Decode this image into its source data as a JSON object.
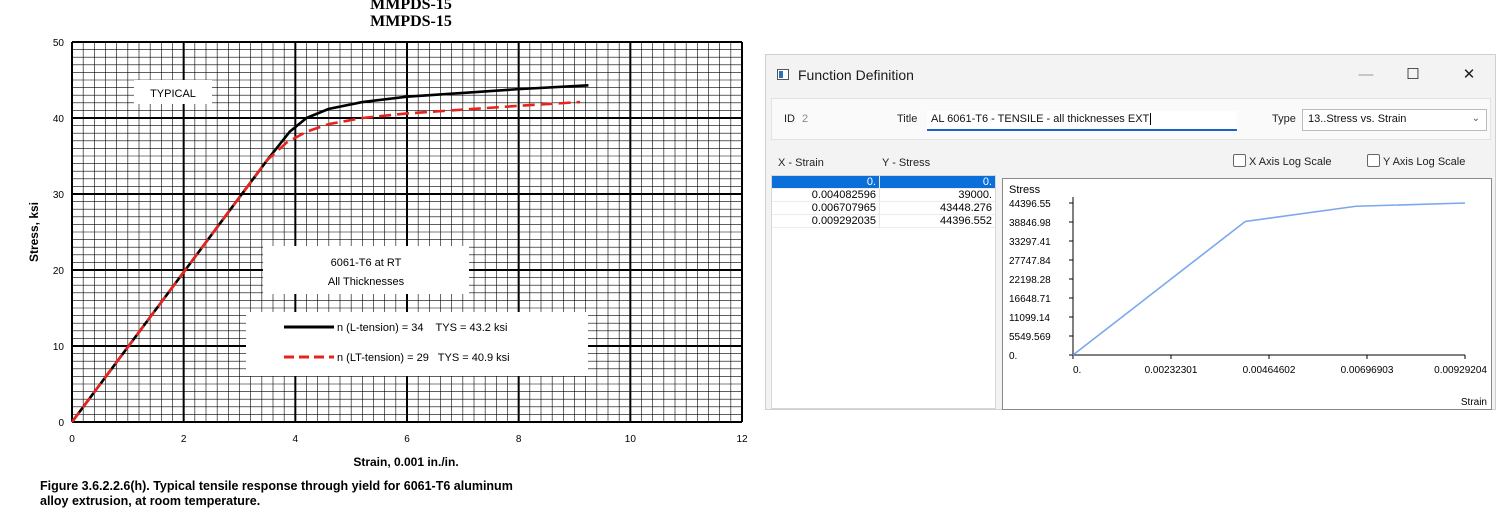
{
  "figure": {
    "header": "MMPDS-15",
    "typical_label": "TYPICAL",
    "legend": {
      "title_line1": "6061-T6 at RT",
      "title_line2": "All Thicknesses",
      "entry1": "n (L-tension) = 34    TYS = 43.2 ksi",
      "entry2": "n (LT-tension) = 29   TYS = 40.9 ksi"
    },
    "caption_line1": "Figure 3.6.2.2.6(h).  Typical tensile response through yield for 6061-T6 aluminum",
    "caption_line2": "alloy extrusion, at room temperature."
  },
  "chart_data": [
    {
      "type": "line",
      "title": "MMPDS-15",
      "xlabel": "Strain, 0.001 in./in.",
      "ylabel": "Stress, ksi",
      "xlim": [
        0,
        12
      ],
      "ylim": [
        0,
        50
      ],
      "x_ticks": [
        "0",
        "2",
        "4",
        "6",
        "8",
        "10",
        "12"
      ],
      "y_ticks": [
        "0",
        "10",
        "20",
        "30",
        "40",
        "50"
      ],
      "grid": true,
      "series": [
        {
          "name": "n (L-tension) = 34    TYS = 43.2 ksi",
          "color": "#000000",
          "style": "solid",
          "x": [
            0,
            3.5,
            3.9,
            4.2,
            4.6,
            5.2,
            6,
            7,
            8,
            9.25
          ],
          "y": [
            0,
            34.5,
            38.2,
            40.0,
            41.2,
            42.1,
            42.8,
            43.3,
            43.8,
            44.3
          ]
        },
        {
          "name": "n (LT-tension) = 29   TYS = 40.9 ksi",
          "color": "#e8231f",
          "style": "dashed",
          "x": [
            0,
            3.5,
            3.85,
            4.2,
            4.6,
            5.2,
            6,
            7,
            8,
            9.1
          ],
          "y": [
            0,
            34.5,
            36.8,
            38.2,
            39.2,
            40.0,
            40.6,
            41.1,
            41.6,
            42.1
          ]
        }
      ]
    },
    {
      "type": "line",
      "title": "",
      "ylabel": "Stress",
      "xlabel": "Strain",
      "x_ticks": [
        "0.",
        "0.00232301",
        "0.00464602",
        "0.00696903",
        "0.00929204"
      ],
      "y_ticks": [
        "0.",
        "5549.569",
        "11099.14",
        "16648.71",
        "22198.28",
        "27747.84",
        "33297.41",
        "38846.98",
        "44396.55"
      ],
      "xlim": [
        0,
        0.00929204
      ],
      "ylim": [
        0,
        44396.55
      ],
      "grid": false,
      "color": "#7aa7ef",
      "series": [
        {
          "x": [
            0,
            0.004082596,
            0.006707965,
            0.009292035
          ],
          "y": [
            0,
            39000,
            43448.276,
            44396.552
          ]
        }
      ]
    }
  ],
  "dialog": {
    "window_title": "Function Definition",
    "minimize_glyph": "—",
    "maximize_glyph": "☐",
    "close_glyph": "✕",
    "id_label": "ID",
    "id_value": "2",
    "title_label": "Title",
    "title_value": "AL 6061-T6 - TENSILE - all thicknesses EXT",
    "type_label": "Type",
    "type_value": "13..Stress vs. Strain",
    "x_col_header": "X - Strain",
    "y_col_header": "Y - Stress",
    "x_log_label": "X Axis Log Scale",
    "y_log_label": "Y Axis Log Scale",
    "rows": [
      {
        "x": "0.",
        "y": "0."
      },
      {
        "x": "0.004082596",
        "y": "39000."
      },
      {
        "x": "0.006707965",
        "y": "43448.276"
      },
      {
        "x": "0.009292035",
        "y": "44396.552"
      }
    ]
  }
}
